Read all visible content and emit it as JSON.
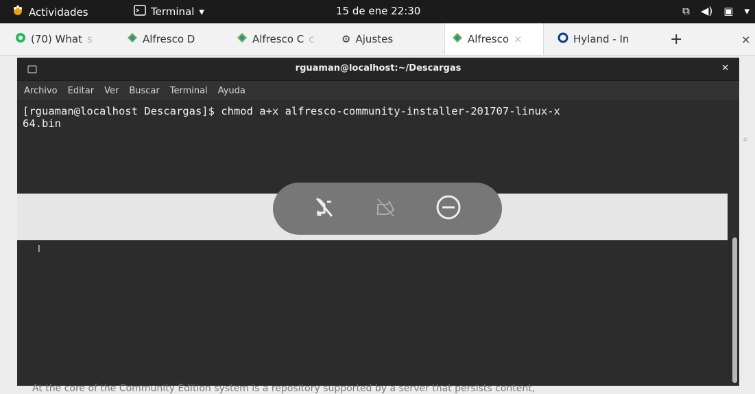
{
  "top_bar": {
    "activities": "Actividades",
    "terminal_menu": "Terminal",
    "clock": "15 de ene 22:30"
  },
  "browser_tabs": [
    {
      "label": "(70) What",
      "fade": "s",
      "icon": "whatsapp-icon"
    },
    {
      "label": "Alfresco D",
      "fade": "",
      "icon": "alfresco-icon"
    },
    {
      "label": "Alfresco C",
      "fade": "c",
      "icon": "alfresco-icon"
    },
    {
      "label": "Ajustes",
      "fade": "",
      "icon": "settings-icon"
    },
    {
      "label": "Alfresco",
      "fade": "",
      "icon": "alfresco-icon",
      "active": true
    },
    {
      "label": "Hyland - In",
      "fade": "",
      "icon": "hyland-icon"
    }
  ],
  "terminal": {
    "title": "rguaman@localhost:~/Descargas",
    "menu": [
      "Archivo",
      "Editar",
      "Ver",
      "Buscar",
      "Terminal",
      "Ayuda"
    ],
    "command": "[rguaman@localhost Descargas]$ chmod a+x alfresco-community-installer-201707-linux-x\n64.bin"
  },
  "page_bottom_text": "At the core of the Community Edition system is a repository supported by a server that persists content,"
}
